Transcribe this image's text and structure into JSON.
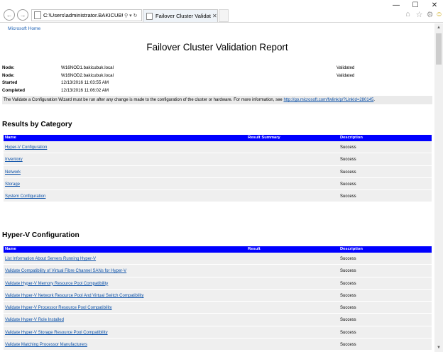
{
  "browser": {
    "address": "C:\\Users\\administrator.BAKICUBUK\\App",
    "tab_title": "Failover Cluster Validation R...",
    "icons": {
      "back": "back-arrow-icon",
      "forward": "forward-arrow-icon",
      "search": "search-icon",
      "dropdown": "chevron-down-icon",
      "refresh": "refresh-icon",
      "home": "home-icon",
      "favorites": "star-icon",
      "settings": "gear-icon",
      "feedback": "smiley-icon"
    }
  },
  "page": {
    "ms_home": "Microsoft Home",
    "title": "Failover Cluster Validation Report",
    "info": [
      {
        "label": "Node:",
        "value": "W16NOD1.bakicubuk.local",
        "status": "Validated"
      },
      {
        "label": "Node:",
        "value": "W16NOD2.bakicubuk.local",
        "status": "Validated"
      },
      {
        "label": "Started",
        "value": "12/13/2016 11:03:55 AM",
        "status": ""
      },
      {
        "label": "Completed",
        "value": "12/13/2016 11:06:02 AM",
        "status": ""
      }
    ],
    "note": {
      "text": "The Validate a Configuration Wizard must be run after any change is made to the configuration of the cluster or hardware. For more information, see ",
      "link": "http://go.microsoft.com/fwlink/p/?LinkId=280145",
      "end": "."
    },
    "results": {
      "heading": "Results by Category",
      "headers": [
        "Name",
        "Result Summary",
        "Description"
      ],
      "rows": [
        {
          "name": "Hyper-V Configuration",
          "desc": "Success"
        },
        {
          "name": "Inventory",
          "desc": "Success"
        },
        {
          "name": "Network",
          "desc": "Success"
        },
        {
          "name": "Storage",
          "desc": "Success"
        },
        {
          "name": "System Configuration",
          "desc": "Success"
        }
      ]
    },
    "hyperv": {
      "heading": "Hyper-V Configuration",
      "headers": [
        "Name",
        "Result",
        "Description"
      ],
      "rows": [
        {
          "name": "List Information About Servers Running Hyper-V",
          "desc": "Success"
        },
        {
          "name": "Validate Compatibility of Virtual Fibre Channel SANs for Hyper-V",
          "desc": "Success"
        },
        {
          "name": "Validate Hyper-V Memory Resource Pool Compatibility",
          "desc": "Success"
        },
        {
          "name": "Validate Hyper-V Network Resource Pool And Virtual Switch Compatibility",
          "desc": "Success"
        },
        {
          "name": "Validate Hyper-V Processor Resource Pool Compatibility",
          "desc": "Success"
        },
        {
          "name": "Validate Hyper-V Role Installed",
          "desc": "Success"
        },
        {
          "name": "Validate Hyper-V Storage Resource Pool Compatibility",
          "desc": "Success"
        },
        {
          "name": "Validate Matching Processor Manufacturers",
          "desc": "Success"
        }
      ]
    }
  }
}
